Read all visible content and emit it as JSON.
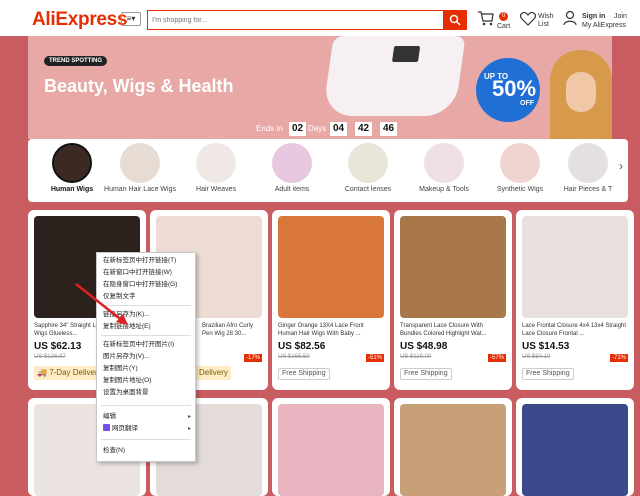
{
  "header": {
    "logo": "AliExpress",
    "category_button": "≡▾",
    "search_placeholder": "I'm shopping for...",
    "cart_label": "Cart",
    "cart_count": "0",
    "wishlist_label": "Wish List",
    "signin_label": "Sign in",
    "join_label": "Join",
    "account_label": "My AliExpress"
  },
  "banner": {
    "tag": "TREND SPOTTING",
    "title": "Beauty, Wigs & Health",
    "badge_up": "UP TO",
    "badge_pct": "50%",
    "badge_off": "OFF",
    "ends_in": "Ends in",
    "days_label": "Days",
    "days": "02",
    "hours": "04",
    "minutes": "42",
    "seconds": "46"
  },
  "categories": [
    {
      "label": "Human Wigs",
      "active": true
    },
    {
      "label": "Human Hair Lace Wigs",
      "active": false
    },
    {
      "label": "Hair Weaves",
      "active": false
    },
    {
      "label": "Adult items",
      "active": false
    },
    {
      "label": "Contact lenses",
      "active": false
    },
    {
      "label": "Makeup & Tools",
      "active": false
    },
    {
      "label": "Synthetic Wigs",
      "active": false
    },
    {
      "label": "Hair Pieces & T",
      "active": false
    }
  ],
  "products": [
    {
      "title": "Sapphire 34\" Straight Lace Frontal Wigs Glueless...",
      "price": "US $62.13",
      "orig": "US $126.87",
      "disc": "",
      "badge": "7-Day Delivery"
    },
    {
      "title": "Brazilian Afro Curly Pen Wig 28 30...",
      "price": "",
      "orig": "",
      "disc": "-17%",
      "badge": "Delivery"
    },
    {
      "title": "Ginger Orange 13X4 Lace Front Human Hair Wigs With Baby ...",
      "price": "US $82.56",
      "orig": "US $165.50",
      "disc": "-51%",
      "badge": "Free Shipping"
    },
    {
      "title": "Transparent Lace Closure With Bundles Colored Highlight Wat...",
      "price": "US $48.98",
      "orig": "US $119.00",
      "disc": "-57%",
      "badge": "Free Shipping"
    },
    {
      "title": "Lace Frontal Closure 4x4 13x4 Straight Lace Closure Frontal ...",
      "price": "US $14.53",
      "orig": "US $50.10",
      "disc": "-71%",
      "badge": "Free Shipping"
    }
  ],
  "context_menu": {
    "items": [
      "在新标签页中打开链接(T)",
      "在新窗口中打开链接(W)",
      "在隐身窗口中打开链接(G)",
      "仅复制文字",
      "链接另存为(K)...",
      "复制链接地址(E)",
      "在新标签页中打开图片(I)",
      "图片另存为(V)...",
      "复制图片(Y)",
      "复制图片地址(O)",
      "设置为桌面背景",
      "编辑",
      "网页翻译",
      "检查(N)"
    ]
  },
  "colors": {
    "brand": "#e62e04",
    "page_bg": "#c85c60",
    "banner_bg": "#e7a8a6",
    "badge_blue": "#1f6fd6"
  }
}
